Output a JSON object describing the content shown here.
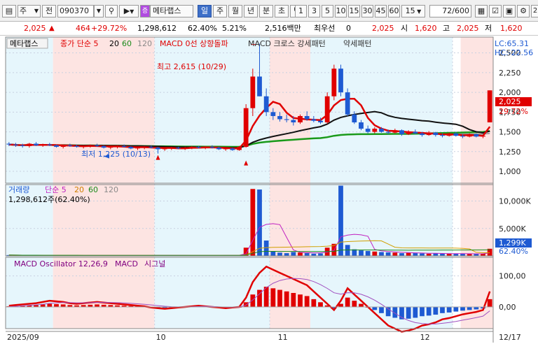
{
  "toolbar": {
    "market_label": "주",
    "scope_label": "전",
    "stock_code": "090370",
    "stock_name": "메타랩스",
    "period_tabs": [
      "일",
      "주",
      "월",
      "년",
      "분",
      "초",
      "틱"
    ],
    "active_period": "일",
    "interval_buttons": [
      "1",
      "3",
      "5",
      "10",
      "15",
      "30",
      "45",
      "60"
    ],
    "interval_select": "15",
    "view_count": "72",
    "view_total": "/600"
  },
  "quote": {
    "price": "2,025",
    "change": "464",
    "change_pct": "+29.72%",
    "volume": "1,298,612",
    "volume_ratio": "62.40%",
    "turnover": "5.21%",
    "amount": "2,516백만",
    "broker_label": "최우선",
    "broker_value": "0",
    "current": "2,025",
    "open_label": "시",
    "open": "1,620",
    "high_label": "고",
    "high": "2,025",
    "low_label": "저",
    "low": "1,620"
  },
  "legend": {
    "stock_name": "메타랩스",
    "close_label": "종가 단순 5",
    "ma20": "20",
    "ma60": "60",
    "ma120": "120",
    "macd_zero": "MACD 0선 상향돌파",
    "macd_cross": "MACD 크로스 강세패턴",
    "weak_pattern": "약세패턴",
    "max_note": "최고 2,615 (10/29)",
    "min_note": "최저 1,225 (10/13)",
    "vol_label": "거래량",
    "vol_ma": "단순 5",
    "vol_ma20": "20",
    "vol_ma60": "60",
    "vol_ma120": "120",
    "vol_value": "1,298,612주(62.40%)",
    "macd_label": "MACD Oscillator 12,26,9",
    "macd_series": "MACD",
    "signal_series": "시그널"
  },
  "right_axis": {
    "price_ticks": [
      "2,500",
      "2,250",
      "2,000",
      "1,750",
      "1,500",
      "1,250",
      "1,000"
    ],
    "lc": "LC:65.31",
    "hc": "HC:-22.56",
    "price_box": "2,025",
    "price_pct": "29.72%",
    "vol_ticks": [
      "10,000K",
      "5,000K"
    ],
    "vol_box": "1,299K",
    "vol_pct": "62.40%",
    "macd_ticks": [
      "100,00",
      "0,00"
    ]
  },
  "date_axis": [
    "2025/09",
    "10",
    "11",
    "12",
    "12/17"
  ],
  "colors": {
    "up": "#e00000",
    "down": "#1e5ad2",
    "bg_pink": "#fde4e2",
    "bg_cyan": "#e6f6fc"
  },
  "chart_data": [
    {
      "type": "candlestick",
      "title": "메타랩스 일봉",
      "ylim": [
        850,
        2700
      ],
      "y_ticks": [
        1000,
        1250,
        1500,
        1750,
        2000,
        2250,
        2500
      ],
      "annotations": [
        {
          "text": "최고 2,615 (10/29)",
          "value": 2615
        },
        {
          "text": "최저 1,225 (10/13)",
          "value": 1225
        }
      ],
      "candles": [
        [
          1350,
          1370,
          1320,
          1340
        ],
        [
          1340,
          1360,
          1310,
          1330
        ],
        [
          1330,
          1350,
          1300,
          1320
        ],
        [
          1320,
          1360,
          1300,
          1350
        ],
        [
          1350,
          1370,
          1320,
          1330
        ],
        [
          1330,
          1350,
          1310,
          1340
        ],
        [
          1340,
          1360,
          1320,
          1330
        ],
        [
          1330,
          1340,
          1300,
          1310
        ],
        [
          1310,
          1340,
          1290,
          1330
        ],
        [
          1330,
          1350,
          1310,
          1320
        ],
        [
          1320,
          1340,
          1300,
          1310
        ],
        [
          1310,
          1330,
          1290,
          1320
        ],
        [
          1320,
          1340,
          1300,
          1330
        ],
        [
          1330,
          1350,
          1310,
          1320
        ],
        [
          1320,
          1330,
          1290,
          1300
        ],
        [
          1300,
          1320,
          1280,
          1310
        ],
        [
          1310,
          1330,
          1290,
          1320
        ],
        [
          1320,
          1340,
          1300,
          1310
        ],
        [
          1310,
          1320,
          1280,
          1290
        ],
        [
          1290,
          1310,
          1270,
          1300
        ],
        [
          1300,
          1320,
          1280,
          1310
        ],
        [
          1310,
          1330,
          1290,
          1300
        ],
        [
          1300,
          1310,
          1225,
          1280
        ],
        [
          1280,
          1300,
          1260,
          1290
        ],
        [
          1290,
          1310,
          1270,
          1300
        ],
        [
          1300,
          1310,
          1280,
          1290
        ],
        [
          1290,
          1310,
          1270,
          1300
        ],
        [
          1300,
          1320,
          1280,
          1310
        ],
        [
          1310,
          1320,
          1290,
          1300
        ],
        [
          1300,
          1320,
          1280,
          1310
        ],
        [
          1310,
          1330,
          1290,
          1300
        ],
        [
          1300,
          1310,
          1270,
          1280
        ],
        [
          1280,
          1300,
          1260,
          1290
        ],
        [
          1290,
          1300,
          1260,
          1270
        ],
        [
          1270,
          1320,
          1260,
          1310
        ],
        [
          1310,
          1850,
          1300,
          1800
        ],
        [
          1800,
          2300,
          1700,
          2200
        ],
        [
          2200,
          2615,
          1950,
          1950
        ],
        [
          1950,
          2050,
          1700,
          1750
        ],
        [
          1750,
          1800,
          1650,
          1700
        ],
        [
          1700,
          1750,
          1630,
          1660
        ],
        [
          1660,
          1720,
          1620,
          1650
        ],
        [
          1650,
          1700,
          1580,
          1620
        ],
        [
          1620,
          1720,
          1600,
          1700
        ],
        [
          1700,
          1760,
          1640,
          1660
        ],
        [
          1660,
          1700,
          1620,
          1640
        ],
        [
          1640,
          1680,
          1600,
          1620
        ],
        [
          1620,
          2000,
          1600,
          1950
        ],
        [
          1950,
          2350,
          1900,
          2300
        ],
        [
          2300,
          2350,
          1950,
          2000
        ],
        [
          2000,
          2050,
          1700,
          1720
        ],
        [
          1720,
          1760,
          1600,
          1620
        ],
        [
          1620,
          1650,
          1520,
          1540
        ],
        [
          1540,
          1580,
          1480,
          1500
        ],
        [
          1500,
          1560,
          1480,
          1540
        ],
        [
          1540,
          1560,
          1490,
          1500
        ],
        [
          1500,
          1530,
          1470,
          1490
        ],
        [
          1490,
          1540,
          1480,
          1520
        ],
        [
          1520,
          1530,
          1450,
          1470
        ],
        [
          1470,
          1520,
          1460,
          1500
        ],
        [
          1500,
          1530,
          1470,
          1480
        ],
        [
          1480,
          1500,
          1440,
          1460
        ],
        [
          1460,
          1510,
          1450,
          1490
        ],
        [
          1490,
          1500,
          1440,
          1460
        ],
        [
          1460,
          1480,
          1430,
          1450
        ],
        [
          1450,
          1490,
          1440,
          1480
        ],
        [
          1480,
          1500,
          1440,
          1450
        ],
        [
          1450,
          1470,
          1420,
          1440
        ],
        [
          1440,
          1480,
          1430,
          1470
        ],
        [
          1470,
          1480,
          1430,
          1440
        ],
        [
          1440,
          1460,
          1420,
          1450
        ],
        [
          1620,
          2025,
          1620,
          2025
        ]
      ]
    },
    {
      "type": "bar",
      "title": "거래량",
      "ylim": [
        0,
        13000
      ],
      "y_ticks": [
        5000,
        10000
      ],
      "unit": "K",
      "values": [
        150,
        120,
        100,
        130,
        110,
        100,
        90,
        110,
        100,
        90,
        100,
        90,
        110,
        100,
        90,
        100,
        110,
        90,
        100,
        120,
        110,
        100,
        150,
        120,
        100,
        90,
        110,
        100,
        90,
        100,
        110,
        120,
        130,
        110,
        120,
        1500,
        12200,
        12100,
        2800,
        800,
        600,
        500,
        700,
        600,
        500,
        400,
        450,
        1500,
        2200,
        12800,
        2000,
        1200,
        1000,
        900,
        800,
        700,
        650,
        600,
        500,
        550,
        500,
        450,
        400,
        450,
        400,
        420,
        380,
        400,
        350,
        380,
        400,
        1299
      ]
    },
    {
      "type": "bar",
      "title": "MACD Oscillator 12,26,9",
      "ylim": [
        -70,
        160
      ],
      "y_ticks": [
        0,
        100
      ],
      "values": [
        2,
        3,
        4,
        5,
        6,
        8,
        10,
        9,
        8,
        6,
        5,
        6,
        7,
        8,
        7,
        6,
        5,
        4,
        3,
        2,
        1,
        -1,
        -2,
        -3,
        -2,
        -1,
        0,
        1,
        2,
        1,
        0,
        -1,
        -2,
        -1,
        0,
        15,
        40,
        55,
        65,
        60,
        55,
        50,
        45,
        40,
        35,
        25,
        15,
        5,
        -5,
        10,
        30,
        20,
        10,
        0,
        -10,
        -20,
        -30,
        -35,
        -40,
        -38,
        -35,
        -30,
        -28,
        -25,
        -20,
        -18,
        -15,
        -12,
        -10,
        -8,
        -5,
        25
      ]
    }
  ]
}
